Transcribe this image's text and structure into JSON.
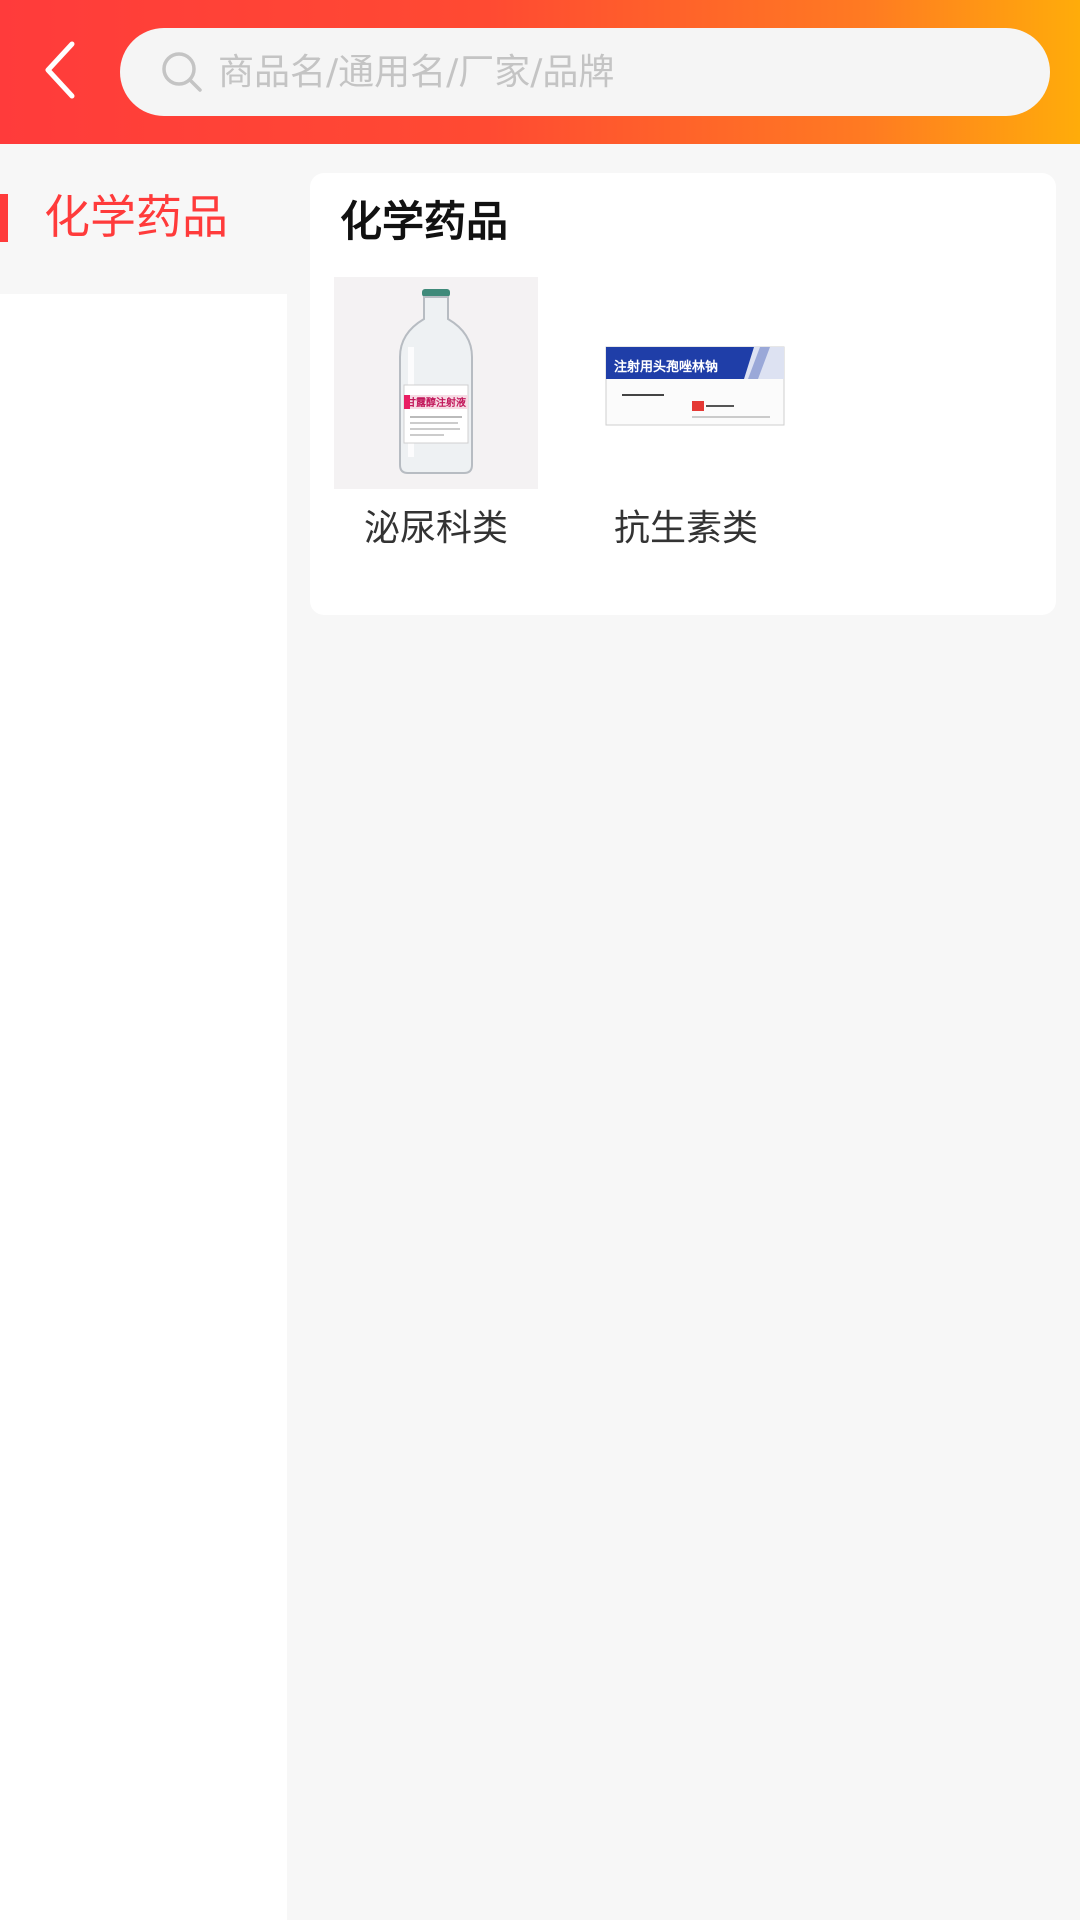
{
  "header": {
    "back_icon": "chevron-left-icon",
    "search": {
      "icon": "search-icon",
      "placeholder": "商品名/通用名/厂家/品牌",
      "value": ""
    }
  },
  "sidebar": {
    "items": [
      {
        "label": "化学药品",
        "active": true
      }
    ]
  },
  "main": {
    "section_title": "化学药品",
    "categories": [
      {
        "name": "泌尿科类",
        "image": "infusion-bottle-image",
        "image_text": "甘露醇注射液"
      },
      {
        "name": "抗生素类",
        "image": "medicine-box-image",
        "image_text": "注射用头孢唑林钠"
      }
    ]
  },
  "colors": {
    "accent": "#ff3b3b",
    "header_gradient_start": "#ff3b3b",
    "header_gradient_end": "#ffac0a",
    "background": "#f7f7f7"
  }
}
